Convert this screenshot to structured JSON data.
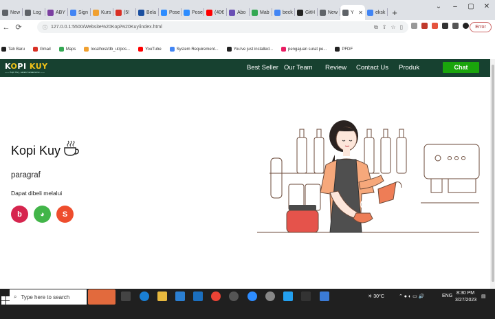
{
  "browser": {
    "tabs": [
      {
        "label": "New",
        "color": "#5f6368"
      },
      {
        "label": "Log",
        "color": "#5f6368"
      },
      {
        "label": "ABY",
        "color": "#7b3fa0"
      },
      {
        "label": "Sign",
        "color": "#4285f4"
      },
      {
        "label": "Kurs",
        "color": "#f0a030"
      },
      {
        "label": "(5!",
        "color": "#d93025"
      },
      {
        "label": "Bela",
        "color": "#1a4fa0"
      },
      {
        "label": "Pose",
        "color": "#2d8cff"
      },
      {
        "label": "Pose",
        "color": "#2d8cff"
      },
      {
        "label": "(40€",
        "color": "#ff0000"
      },
      {
        "label": "Abo",
        "color": "#6a4fb5"
      },
      {
        "label": "Mab",
        "color": "#34a853"
      },
      {
        "label": "beck",
        "color": "#4285f4"
      },
      {
        "label": "GitH",
        "color": "#222"
      },
      {
        "label": "New",
        "color": "#5f6368"
      },
      {
        "label": "Y",
        "color": "#5f6368"
      },
      {
        "label": "eksk",
        "color": "#4285f4"
      }
    ],
    "active_tab_index": 15,
    "new_tab_symbol": "+",
    "window_controls": [
      "⌄",
      "–",
      "▢",
      "✕"
    ],
    "url": "127.0.0.1:5500/Website%20Kopi%20Kuy/index.html",
    "error_label": "Error",
    "bookmarks": [
      {
        "label": "Tab Baru",
        "color": "#222"
      },
      {
        "label": "Gmail",
        "color": "#d93025"
      },
      {
        "label": "Maps",
        "color": "#34a853"
      },
      {
        "label": "localhost/db_ut/pos...",
        "color": "#f0a030"
      },
      {
        "label": "YouTube",
        "color": "#ff0000"
      },
      {
        "label": "System Requirement...",
        "color": "#4285f4"
      },
      {
        "label": "You've just installed...",
        "color": "#222"
      },
      {
        "label": "pengajuan surat pe...",
        "color": "#e91e63"
      },
      {
        "label": "PFDF",
        "color": "#222"
      }
    ]
  },
  "site": {
    "logo_k": "K",
    "logo_o": "O",
    "logo_rest": "PI ",
    "logo_kuy": "KUY",
    "logo_tagline": "—— Kopi Kuy, selalu bersamamu ——",
    "menu": [
      "Best Seller",
      "Our Team",
      "Review",
      "Contact Us",
      "Produk"
    ],
    "chat_label": "Chat",
    "hero": {
      "title": "Kopi Kuy",
      "paragraph": "paragraf",
      "subtitle": "Dapat dibeli melalui",
      "apps": [
        {
          "name": "gojek",
          "symbol": "b",
          "color": "#d6254e"
        },
        {
          "name": "tokopedia",
          "symbol": "◕",
          "color": "#42b549"
        },
        {
          "name": "shopee",
          "symbol": "S",
          "color": "#ee4d2d"
        }
      ]
    },
    "colors": {
      "nav_bg": "#174130",
      "chat_bg": "#1aa50c",
      "accent": "#f2c318"
    }
  },
  "taskbar": {
    "search_placeholder": "Type here to search",
    "weather": "30°C",
    "lang": "ENG",
    "time": "8:30 PM",
    "date": "3/27/2023"
  }
}
